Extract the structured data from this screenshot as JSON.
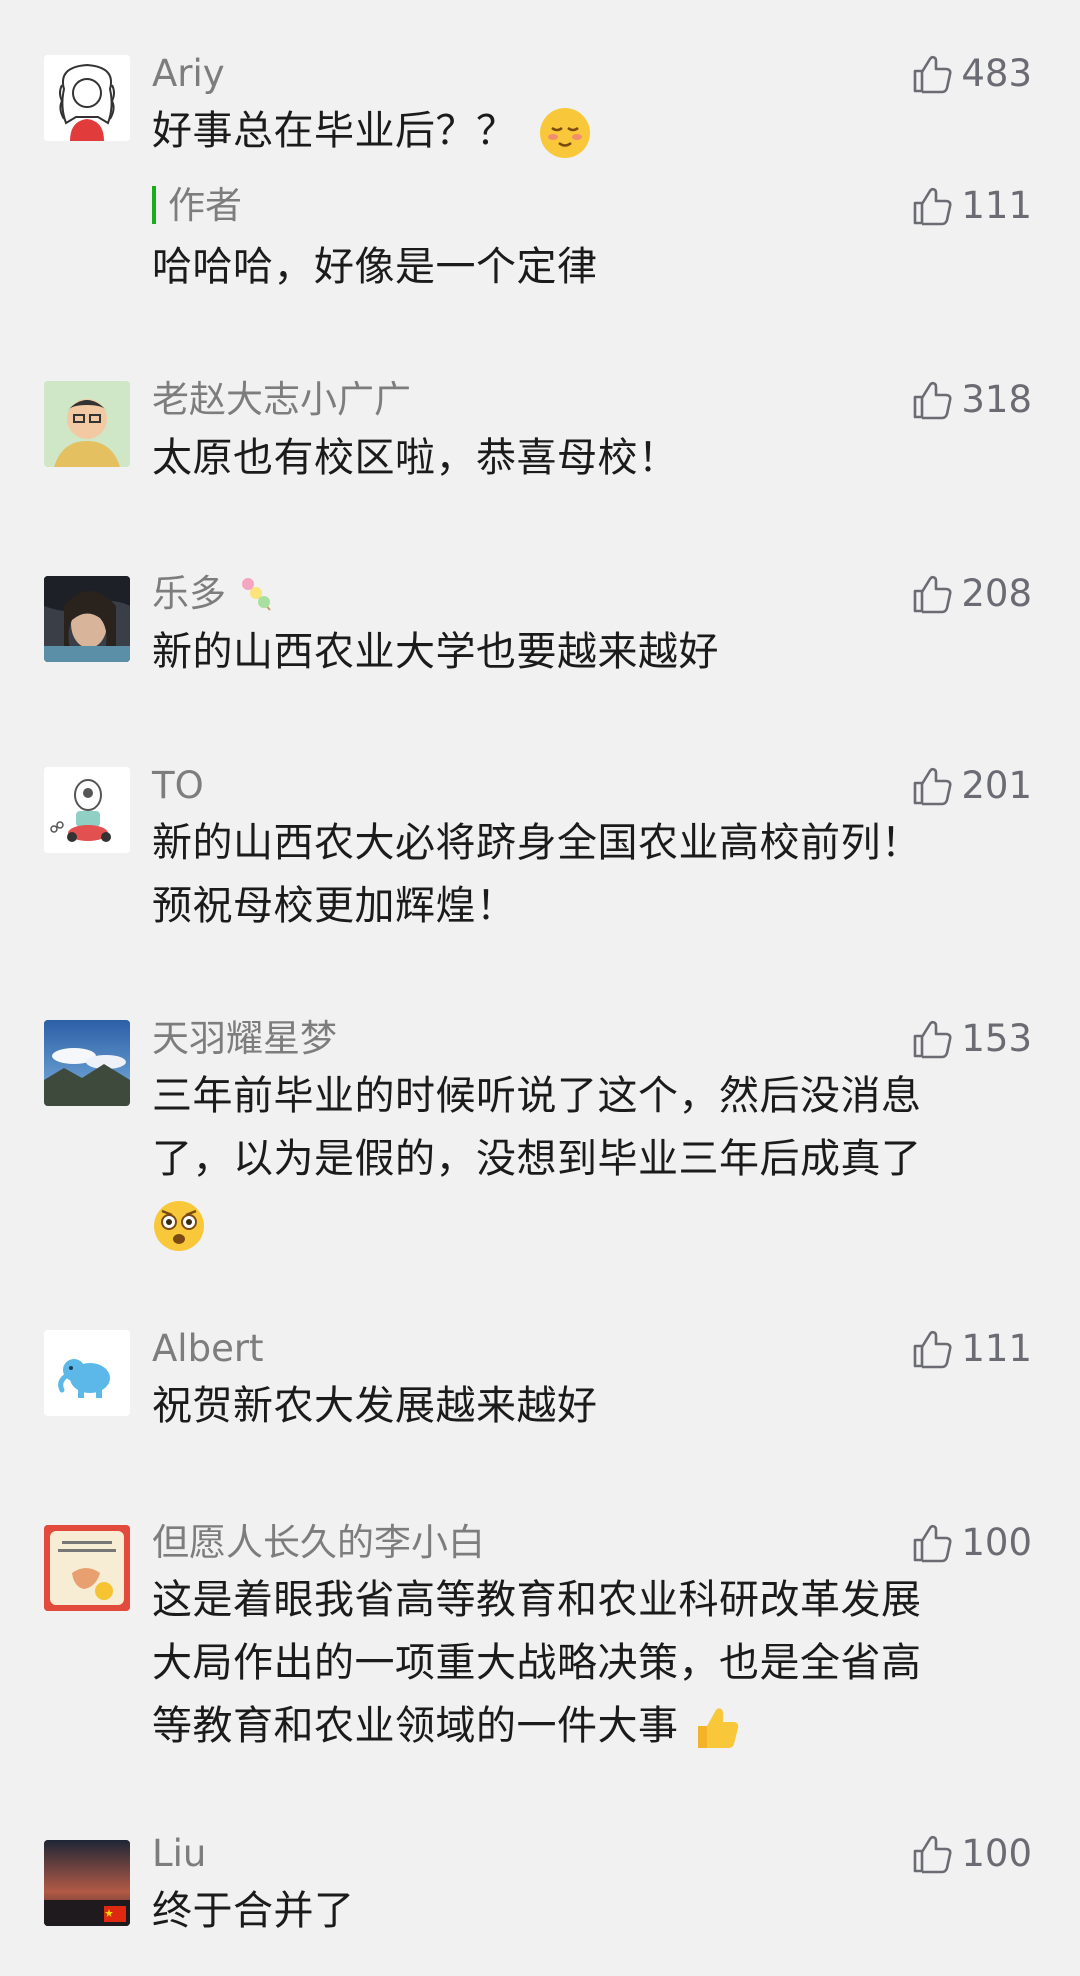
{
  "comments": [
    {
      "name": "Ariy",
      "text": "好事总在毕业后？？",
      "likes": "483",
      "reply": {
        "name": "作者",
        "text": "哈哈哈，好像是一个定律",
        "likes": "111"
      }
    },
    {
      "name": "老赵大志小广广",
      "text": "太原也有校区啦，恭喜母校！",
      "likes": "318"
    },
    {
      "name": "乐多",
      "text": "新的山西农业大学也要越来越好",
      "likes": "208"
    },
    {
      "name": "TO",
      "text_lines": [
        "新的山西农大必将跻身全国农业高校前列！",
        "预祝母校更加辉煌！"
      ],
      "likes": "201"
    },
    {
      "name": "天羽耀星梦",
      "text_lines": [
        "三年前毕业的时候听说了这个，然后没消息",
        "了，以为是假的，没想到毕业三年后成真了"
      ],
      "likes": "153"
    },
    {
      "name": "Albert",
      "text": "祝贺新农大发展越来越好",
      "likes": "111"
    },
    {
      "name": "但愿人长久的李小白",
      "text_lines": [
        "这是着眼我省高等教育和农业科研改革发展",
        "大局作出的一项重大战略决策，也是全省高",
        "等教育和农业领域的一件大事"
      ],
      "likes": "100"
    },
    {
      "name": "Liu",
      "text": "终于合并了",
      "likes": "100"
    }
  ],
  "icons": {
    "like": "thumbs-up-icon",
    "emoji_blush": "blush-emoji-icon",
    "emoji_shocked": "shocked-emoji-icon",
    "emoji_thumbs": "thumbs-up-emoji-icon",
    "candy": "tanghulu-icon"
  },
  "colors": {
    "author_bar": "#1aad19",
    "name": "#7d7d7d",
    "text": "#1b1b1b",
    "background": "#f1f1f1"
  }
}
